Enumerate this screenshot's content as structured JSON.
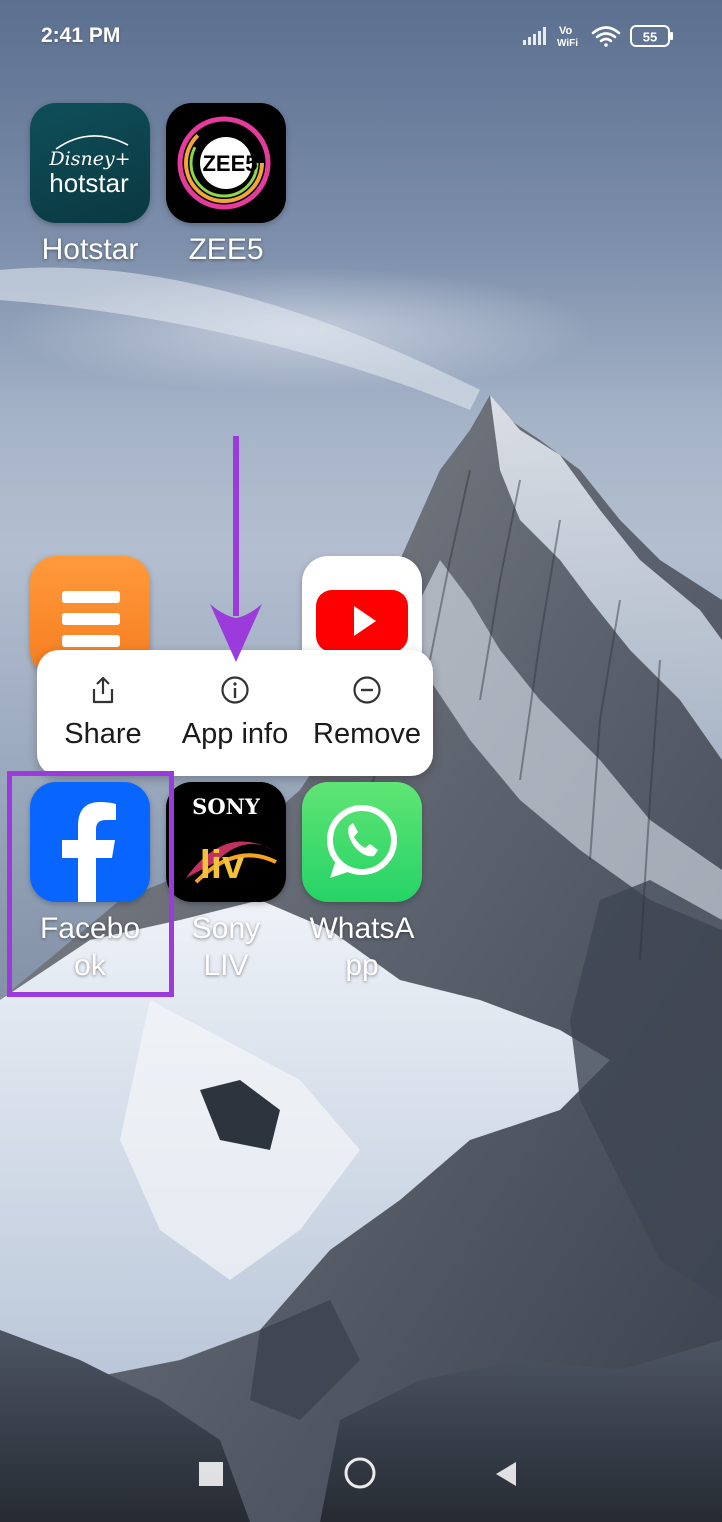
{
  "status_bar": {
    "time": "2:41 PM",
    "vowifi": [
      "Vo",
      "WiFi"
    ],
    "battery": "55",
    "icons": [
      "signal-icon",
      "vowifi-icon",
      "wifi-icon",
      "battery-icon"
    ]
  },
  "apps": {
    "hotstar": {
      "label": "Hotstar",
      "logo_top": "Disney+",
      "logo_bottom": "hotstar"
    },
    "zee5": {
      "label": "ZEE5",
      "logo_text": "ZEE5"
    },
    "orange_app": {
      "label": ""
    },
    "youtube": {
      "label": ""
    },
    "facebook": {
      "label": "Facebo\nok",
      "logo": "f"
    },
    "sonyliv": {
      "label": "Sony\nLIV",
      "logo_top": "SONY",
      "logo_bottom": "liv"
    },
    "whatsapp": {
      "label": "WhatsA\npp"
    }
  },
  "app_menu": {
    "items": [
      {
        "label": "Share",
        "icon": "share-icon"
      },
      {
        "label": "App info",
        "icon": "info-icon"
      },
      {
        "label": "Remove",
        "icon": "remove-icon"
      }
    ]
  },
  "annotations": {
    "highlight_color": "#9b3bdc",
    "arrow_color": "#9b3bdc"
  },
  "nav_bar": {
    "buttons": [
      "recents-button",
      "home-button",
      "back-button"
    ]
  }
}
